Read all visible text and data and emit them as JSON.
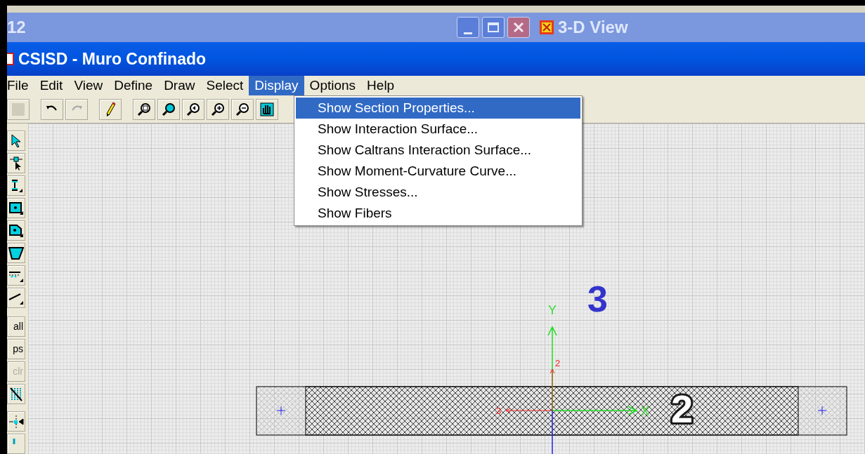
{
  "background_windows": [
    {
      "title": "12"
    },
    {
      "title": "3-D View"
    }
  ],
  "window": {
    "title": "CSISD - Muro Confinado"
  },
  "menu": [
    {
      "label": "File",
      "selected": false
    },
    {
      "label": "Edit",
      "selected": false
    },
    {
      "label": "View",
      "selected": false
    },
    {
      "label": "Define",
      "selected": false
    },
    {
      "label": "Draw",
      "selected": false
    },
    {
      "label": "Select",
      "selected": false
    },
    {
      "label": "Display",
      "selected": true
    },
    {
      "label": "Options",
      "selected": false
    },
    {
      "label": "Help",
      "selected": false
    }
  ],
  "dropdown": [
    {
      "label": "Show Section Properties...",
      "selected": true
    },
    {
      "label": "Show Interaction Surface...",
      "selected": false
    },
    {
      "label": "Show Caltrans Interaction Surface...",
      "selected": false
    },
    {
      "label": "Show Moment-Curvature Curve...",
      "selected": false
    },
    {
      "label": "Show Stresses...",
      "selected": false
    },
    {
      "label": "Show Fibers",
      "selected": false
    }
  ],
  "side_text_tools": [
    {
      "label": "all",
      "disabled": false
    },
    {
      "label": "ps",
      "disabled": false
    },
    {
      "label": "clr",
      "disabled": true
    }
  ],
  "canvas": {
    "labels": [
      {
        "text": "3",
        "kind": "callout",
        "color": "#3333cc"
      },
      {
        "text": "Y",
        "kind": "axis",
        "color": "#33dd33"
      },
      {
        "text": "2",
        "kind": "local",
        "color": "#ee2222"
      },
      {
        "text": "3",
        "kind": "local",
        "color": "#ee2222"
      },
      {
        "text": "X",
        "kind": "axis",
        "color": "#33dd33"
      },
      {
        "text": "2",
        "kind": "callout",
        "color": "#ffffff"
      }
    ]
  }
}
